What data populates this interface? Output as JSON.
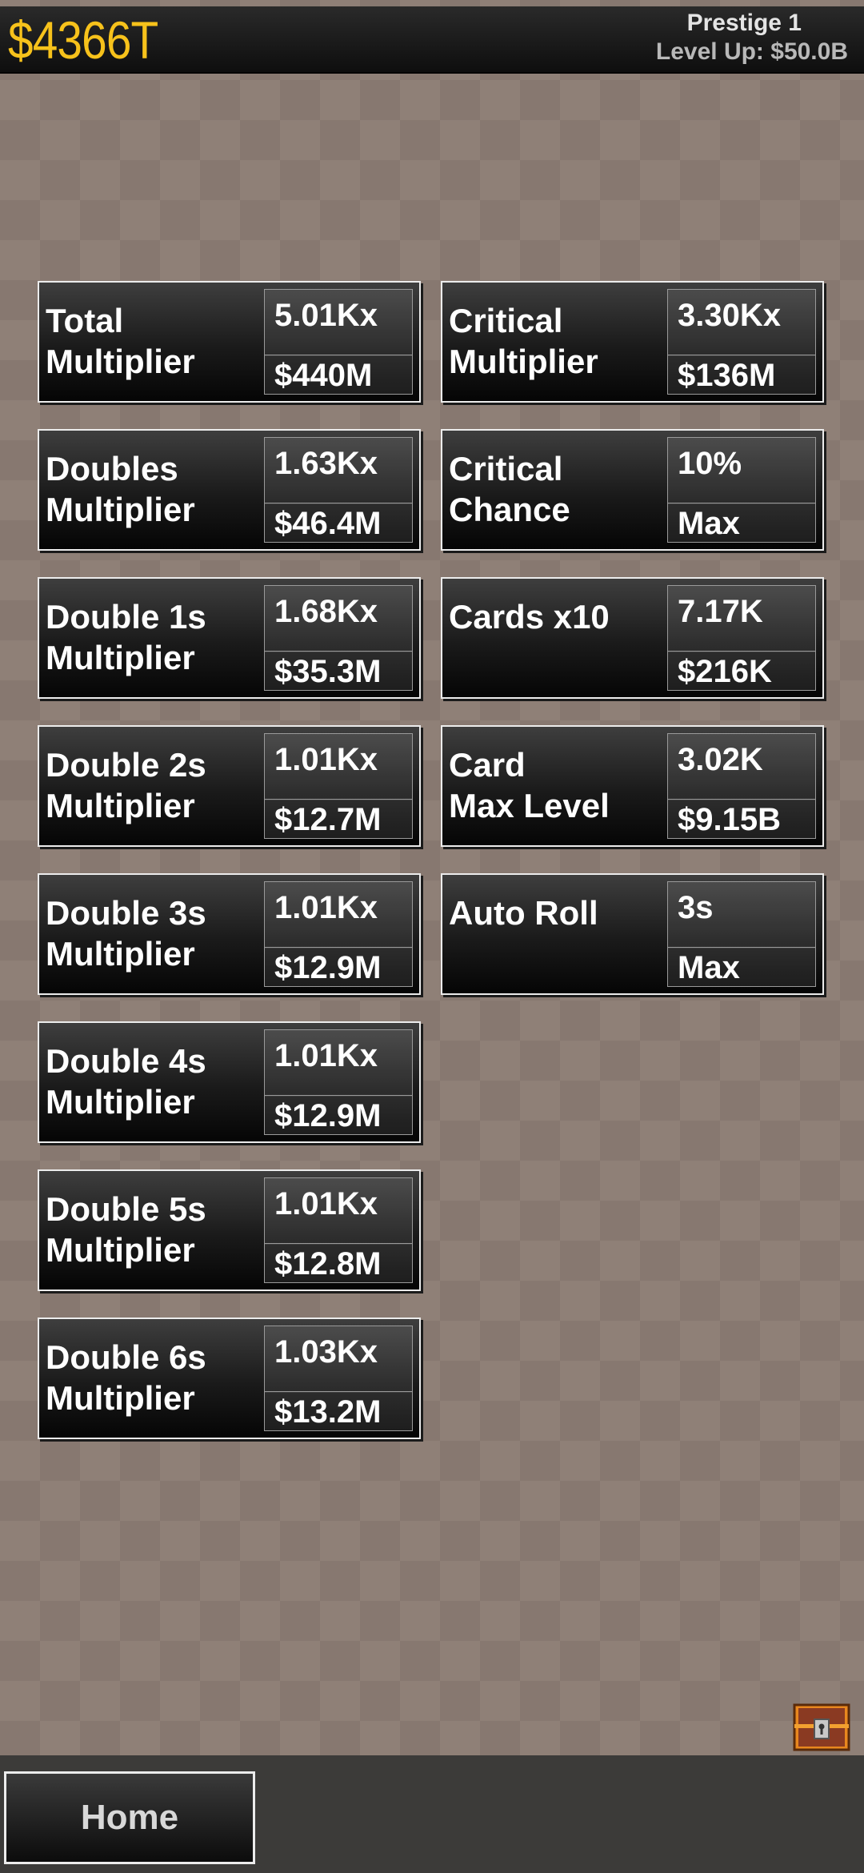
{
  "header": {
    "money": "$4366T",
    "prestige": "Prestige 1",
    "level_up": "Level Up: $50.0B"
  },
  "upgrades_left": [
    {
      "title": "Total\nMultiplier",
      "value": "5.01Kx",
      "cost": "$440M"
    },
    {
      "title": "Doubles\nMultiplier",
      "value": "1.63Kx",
      "cost": "$46.4M"
    },
    {
      "title": "Double 1s\nMultiplier",
      "value": "1.68Kx",
      "cost": "$35.3M"
    },
    {
      "title": "Double 2s\nMultiplier",
      "value": "1.01Kx",
      "cost": "$12.7M"
    },
    {
      "title": "Double 3s\nMultiplier",
      "value": "1.01Kx",
      "cost": "$12.9M"
    },
    {
      "title": "Double 4s\nMultiplier",
      "value": "1.01Kx",
      "cost": "$12.9M"
    },
    {
      "title": "Double 5s\nMultiplier",
      "value": "1.01Kx",
      "cost": "$12.8M"
    },
    {
      "title": "Double 6s\nMultiplier",
      "value": "1.03Kx",
      "cost": "$13.2M"
    }
  ],
  "upgrades_right": [
    {
      "title": "Critical\nMultiplier",
      "value": "3.30Kx",
      "cost": "$136M"
    },
    {
      "title": "Critical\nChance",
      "value": "10%",
      "cost": "Max"
    },
    {
      "title": "Cards x10",
      "value": "7.17K",
      "cost": "$216K"
    },
    {
      "title": "Card\nMax Level",
      "value": "3.02K",
      "cost": "$9.15B"
    },
    {
      "title": "Auto Roll",
      "value": "3s",
      "cost": "Max"
    }
  ],
  "chest_icon": "treasure-chest-icon",
  "footer": {
    "home_label": "Home"
  }
}
